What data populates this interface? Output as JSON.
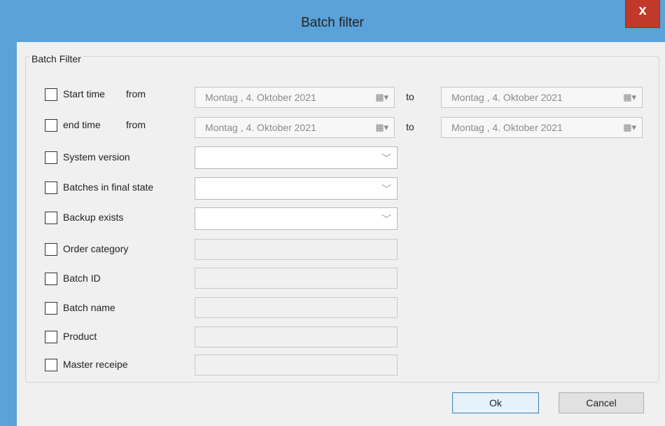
{
  "window": {
    "title": "Batch filter",
    "close_label": "x"
  },
  "group": {
    "label": "Batch Filter"
  },
  "date_filters": [
    {
      "label": "Start time",
      "from_label": "from",
      "from_date": "Montag   ,  4.  Oktober  2021",
      "to_label": "to",
      "to_date": "Montag   ,  4.  Oktober  2021"
    },
    {
      "label": "end time",
      "from_label": "from",
      "from_date": "Montag   ,  4.  Oktober  2021",
      "to_label": "to",
      "to_date": "Montag   ,  4.  Oktober  2021"
    }
  ],
  "combo_filters": [
    {
      "label": "System version",
      "value": ""
    },
    {
      "label": "Batches in final state",
      "value": ""
    },
    {
      "label": "Backup exists",
      "value": ""
    }
  ],
  "text_filters": [
    {
      "label": "Order category",
      "value": ""
    },
    {
      "label": "Batch ID",
      "value": ""
    },
    {
      "label": "Batch name",
      "value": ""
    },
    {
      "label": "Product",
      "value": ""
    },
    {
      "label": "Master receipe",
      "value": ""
    }
  ],
  "buttons": {
    "ok": "Ok",
    "cancel": "Cancel"
  },
  "icons": {
    "calendar": "calendar-icon",
    "chevron": "chevron-down-icon",
    "close": "close-icon"
  },
  "colors": {
    "titlebar": "#5aa2d8",
    "close": "#c0392b",
    "client": "#f0f0f0"
  }
}
